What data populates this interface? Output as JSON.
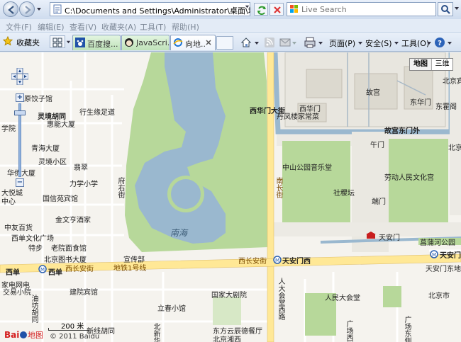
{
  "browser": {
    "address": "C:\\Documents and Settings\\Administrator\\桌面\\地图\\baidu-map",
    "search_placeholder": "Live Search"
  },
  "menu": [
    "文件(F)",
    "编辑(E)",
    "查看(V)",
    "收藏夹(A)",
    "工具(T)",
    "帮助(H)"
  ],
  "favorites_label": "收藏夹",
  "tabs": [
    {
      "label": "百度搜..."
    },
    {
      "label": "JavaScri..."
    },
    {
      "label": "向地..."
    }
  ],
  "commands": {
    "page": "页面(P)",
    "safety": "安全(S)",
    "tools": "工具(O)"
  },
  "map": {
    "map_type": {
      "map": "地图",
      "three_d": "三维"
    },
    "scale": "200 米",
    "copyright": "© 2011 Baidu",
    "logo": "Bai地图",
    "labels": {
      "zhenggu": "原饺子馆",
      "linjing": "灵境胡同",
      "xingsheng": "行生缘足道",
      "huineng": "惠能大厦",
      "xueyuan": "学院",
      "qinghai": "青海大厦",
      "linjingxq": "灵境小区",
      "feijia": "翡翠",
      "huaqiao": "华侨大厦",
      "lixiao": "力学小学",
      "guoyuan": "国信苑宾馆",
      "jinwen": "金文亨酒家",
      "dayue": "大悦城",
      "zhongxin": "中心",
      "zhongyou": "中友百货",
      "xidan_culture": "西单文化广场",
      "laojia": "老院面食馆",
      "tesu": "特步",
      "library": "北京图书大厦",
      "xuansheng": "宣传部",
      "fuyoujie": "府右街",
      "nanhai": "南海",
      "xihuamen": "西华门大街",
      "danfeng": "丹凤楼家常菜",
      "xihuamen_gate": "西华门",
      "gugong": "故宫",
      "donghuamen": "东华门",
      "gugong_east": "故宫东门外",
      "beijing_east": "北京宾",
      "dongguo": "东霍阁",
      "beijing_tax": "北京税务",
      "wumen": "午门",
      "zhongshan": "中山公园音乐堂",
      "nanchangjie": "南长街",
      "laodong": "劳动人民文化宫",
      "shejitan": "社稷坛",
      "duanmen": "端门",
      "tiananmen": "天安门",
      "changpu": "菖蒲河公园",
      "xidan_station": "西单",
      "xichang_road": "西长安街",
      "line1": "地铁1号线",
      "tam_west": "天安门西",
      "tam_east": "天安门",
      "xidan_post": "家电网电",
      "jiaoyiyuan": "交易小院",
      "jianye": "建院宾馆",
      "youfang": "油坊胡同",
      "guojiada": "国家大剧院",
      "renmin": "人民大会堂",
      "renmin_w": "人大会堂西路",
      "guangchang_w": "广场西侧路",
      "guangchang_e": "广场东侧路",
      "lichun": "立春小馆",
      "dongfang": "东方云辰德餐厅",
      "beijing_xiang": "北京湘西",
      "tam_east_station": "天安门东地铁站派出所",
      "beijing_cunguan": "北京市",
      "xinxian": "新线胡同",
      "beixin": "北新华街"
    }
  }
}
